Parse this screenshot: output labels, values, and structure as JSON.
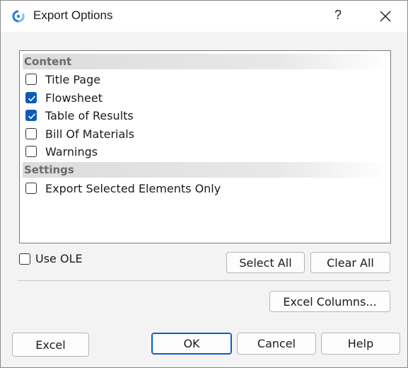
{
  "window": {
    "title": "Export Options",
    "help_glyph": "?",
    "close_icon": "close-icon",
    "app_icon": "app-logo-icon"
  },
  "content_list": {
    "groups": [
      {
        "header": "Content",
        "items": [
          {
            "label": "Title Page",
            "checked": false
          },
          {
            "label": "Flowsheet",
            "checked": true
          },
          {
            "label": "Table of Results",
            "checked": true
          },
          {
            "label": "Bill Of Materials",
            "checked": false
          },
          {
            "label": "Warnings",
            "checked": false
          }
        ]
      },
      {
        "header": "Settings",
        "items": [
          {
            "label": "Export Selected Elements Only",
            "checked": false
          }
        ]
      }
    ]
  },
  "options": {
    "use_ole_label": "Use OLE",
    "use_ole_checked": false
  },
  "buttons": {
    "select_all": "Select All",
    "clear_all": "Clear All",
    "excel_columns": "Excel Columns...",
    "excel": "Excel",
    "ok": "OK",
    "cancel": "Cancel",
    "help": "Help"
  },
  "colors": {
    "accent": "#0b5cb8",
    "group_header_text": "#6b6b6b",
    "dialog_bg": "#f3f3f3"
  }
}
